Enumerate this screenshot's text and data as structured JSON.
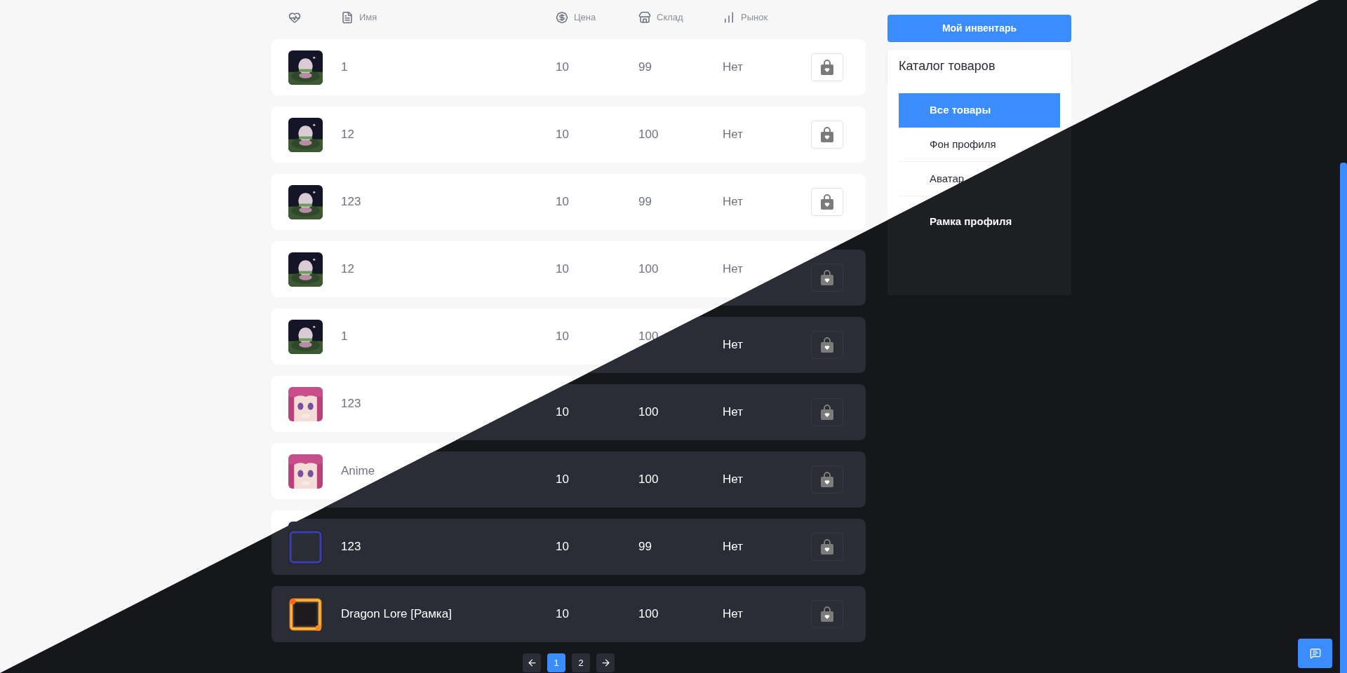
{
  "light": {
    "columns": [
      {
        "kind": "status"
      },
      {
        "kind": "name",
        "label": "Имя"
      },
      {
        "kind": "price",
        "label": "Цена"
      },
      {
        "kind": "stock",
        "label": "Склад"
      },
      {
        "kind": "market",
        "label": "Рынок"
      }
    ],
    "rows": [
      {
        "kind": "buyable",
        "name": "1",
        "price": "10",
        "stock": "99",
        "market": "Нет"
      },
      {
        "kind": "buyable",
        "name": "12",
        "price": "10",
        "stock": "100",
        "market": "Нет"
      },
      {
        "kind": "buyable",
        "name": "123",
        "price": "10",
        "stock": "99",
        "market": "Нет"
      },
      {
        "kind": "plain",
        "name": "12",
        "price": "10",
        "stock": "100",
        "market": "Нет"
      },
      {
        "kind": "plain",
        "name": "1",
        "price": "10",
        "stock": "100"
      },
      {
        "kind": "plain",
        "name": "123"
      },
      {
        "kind": "plain",
        "name": "Anime"
      },
      {
        "kind": "plain"
      }
    ],
    "inventory_button": "Мой инвентарь",
    "catalog_title": "Каталог товаров",
    "sidebar_items": [
      {
        "label": "Все товары",
        "selected": true
      },
      {
        "label": "Фон профиля",
        "selected": false
      },
      {
        "label": "Аватар",
        "selected": false
      }
    ]
  },
  "dark": {
    "rows": [
      {
        "kind": "buyable"
      },
      {
        "kind": "buyable",
        "market": "Нет"
      },
      {
        "kind": "buyable",
        "price": "10",
        "stock": "100",
        "market": "Нет"
      },
      {
        "kind": "buyable",
        "price": "10",
        "stock": "100",
        "market": "Нет"
      },
      {
        "kind": "buyable",
        "name": "123",
        "price": "10",
        "stock": "99",
        "market": "Нет"
      },
      {
        "kind": "buyable",
        "name": "Dragon Lore [Рамка]",
        "price": "10",
        "stock": "100",
        "market": "Нет"
      }
    ],
    "sidebar_items": [
      {
        "label": "Рамка профиля",
        "selected": false
      }
    ],
    "pagination": [
      {
        "kind": "prev"
      },
      {
        "kind": "page",
        "label": "1",
        "selected": true
      },
      {
        "kind": "page",
        "label": "2",
        "selected": false
      },
      {
        "kind": "next"
      }
    ]
  }
}
